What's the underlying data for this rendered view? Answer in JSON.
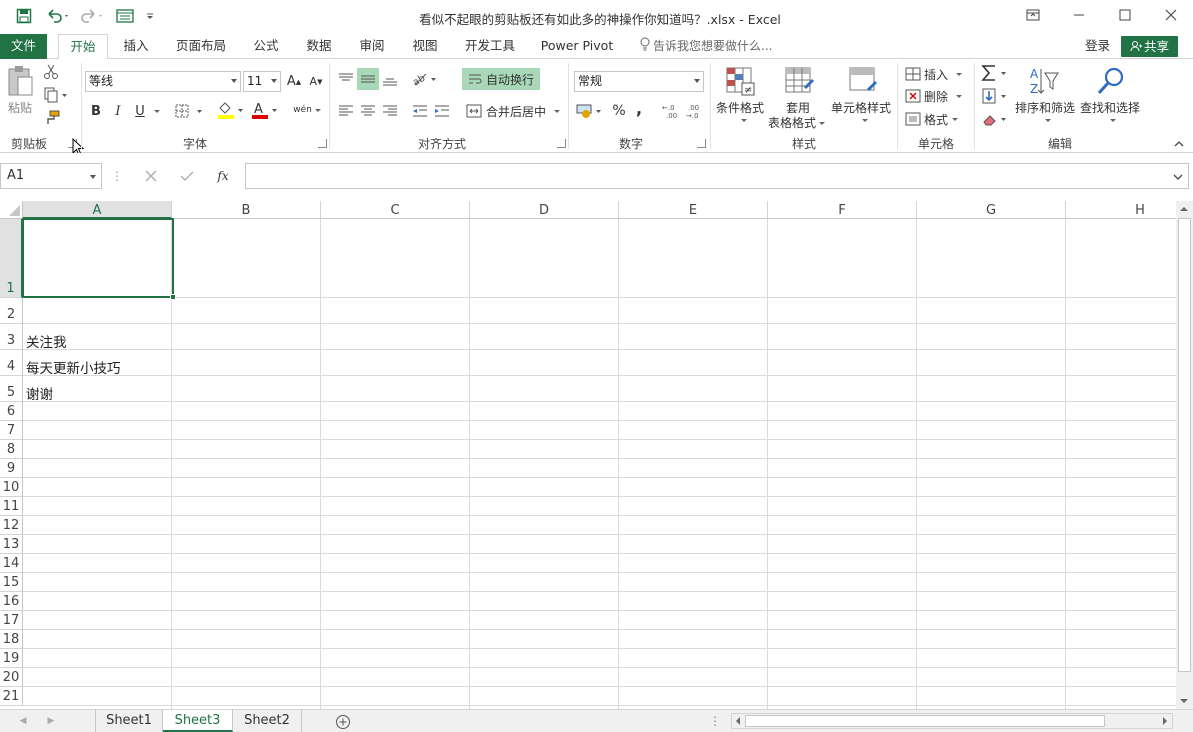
{
  "window": {
    "title": "看似不起眼的剪贴板还有如此多的神操作你知道吗？.xlsx - Excel"
  },
  "tabs": {
    "file": "文件",
    "home": "开始",
    "insert": "插入",
    "page_layout": "页面布局",
    "formulas": "公式",
    "data": "数据",
    "review": "审阅",
    "view": "视图",
    "developer": "开发工具",
    "power_pivot": "Power Pivot"
  },
  "tell_me": "告诉我您想要做什么...",
  "login": "登录",
  "share": "共享",
  "ribbon": {
    "clipboard": {
      "paste": "粘贴",
      "group": "剪贴板"
    },
    "font": {
      "name": "等线",
      "size": "11",
      "bold": "B",
      "italic": "I",
      "underline": "U",
      "phonetic": "wén",
      "group": "字体"
    },
    "alignment": {
      "wrap": "自动换行",
      "merge": "合并后居中",
      "group": "对齐方式"
    },
    "number": {
      "format": "常规",
      "percent": "%",
      "comma": ",",
      "group": "数字"
    },
    "styles": {
      "conditional": "条件格式",
      "table_line1": "套用",
      "table_line2": "表格格式",
      "cell_styles": "单元格样式",
      "group": "样式"
    },
    "cells": {
      "insert": "插入",
      "delete": "删除",
      "format": "格式",
      "group": "单元格"
    },
    "editing": {
      "sort": "排序和筛选",
      "find": "查找和选择",
      "group": "编辑"
    }
  },
  "formula_bar": {
    "name_box": "A1",
    "fx": "fx",
    "content": ""
  },
  "columns": [
    "A",
    "B",
    "C",
    "D",
    "E",
    "F",
    "G",
    "H"
  ],
  "rows": [
    "1",
    "2",
    "3",
    "4",
    "5",
    "6",
    "7",
    "8",
    "9",
    "10",
    "11",
    "12",
    "13",
    "14",
    "15",
    "16",
    "17",
    "18",
    "19",
    "20",
    "21"
  ],
  "cells": {
    "A3": "关注我",
    "A4": "每天更新小技巧",
    "A5": "谢谢"
  },
  "sheets": [
    "Sheet1",
    "Sheet3",
    "Sheet2"
  ],
  "active_sheet": "Sheet3",
  "colors": {
    "accent": "#217346",
    "wrap_highlight": "#a9d8b8"
  }
}
